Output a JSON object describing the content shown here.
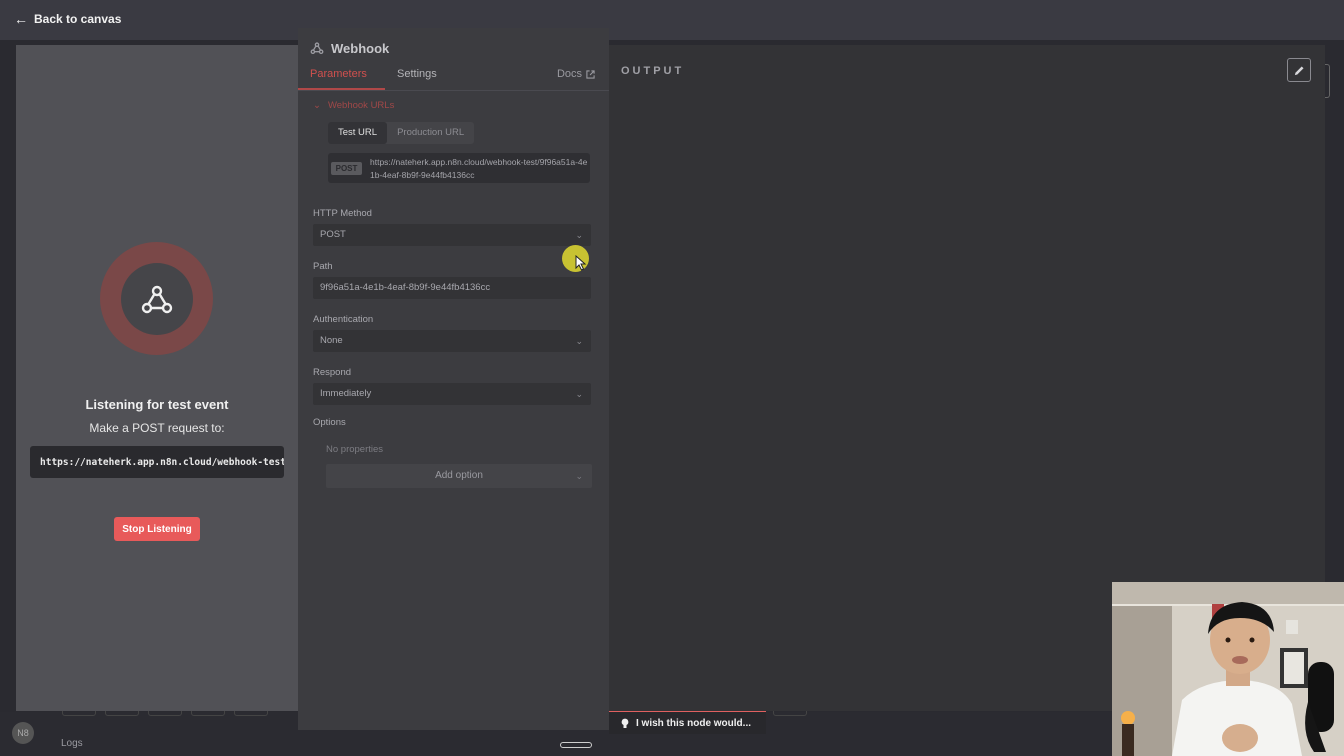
{
  "topbar": {
    "back_label": "Back to canvas"
  },
  "input_panel": {
    "listening_title": "Listening for test event",
    "listening_sub": "Make a POST request to:",
    "url": "https://nateherk.app.n8n.cloud/webhook-test",
    "stop_button": "Stop Listening"
  },
  "node": {
    "title": "Webhook",
    "tabs": [
      "Parameters",
      "Settings"
    ],
    "active_tab": "Parameters",
    "docs_label": "Docs",
    "webhook_urls_section": "Webhook URLs",
    "url_tabs": [
      "Test URL",
      "Production URL"
    ],
    "active_url_tab": "Test URL",
    "method_badge": "POST",
    "webhook_url": "https://nateherk.app.n8n.cloud/webhook-test/9f96a51a-4e1b-4eaf-8b9f-9e44fb4136cc",
    "fields": {
      "http_method": {
        "label": "HTTP Method",
        "value": "POST"
      },
      "path": {
        "label": "Path",
        "value": "9f96a51a-4e1b-4eaf-8b9f-9e44fb4136cc"
      },
      "authentication": {
        "label": "Authentication",
        "value": "None"
      },
      "respond": {
        "label": "Respond",
        "value": "Immediately"
      }
    },
    "options_label": "Options",
    "no_properties": "No properties",
    "add_option": "Add option"
  },
  "output": {
    "title": "OUTPUT"
  },
  "feedback": {
    "label": "I wish this node would..."
  },
  "bottom": {
    "logs_label": "Logs",
    "avatar_initials": "N8"
  },
  "colors": {
    "accent_red": "#e85a5a",
    "listen_ring": "#7a4848",
    "cursor_highlight": "#c8c232"
  }
}
